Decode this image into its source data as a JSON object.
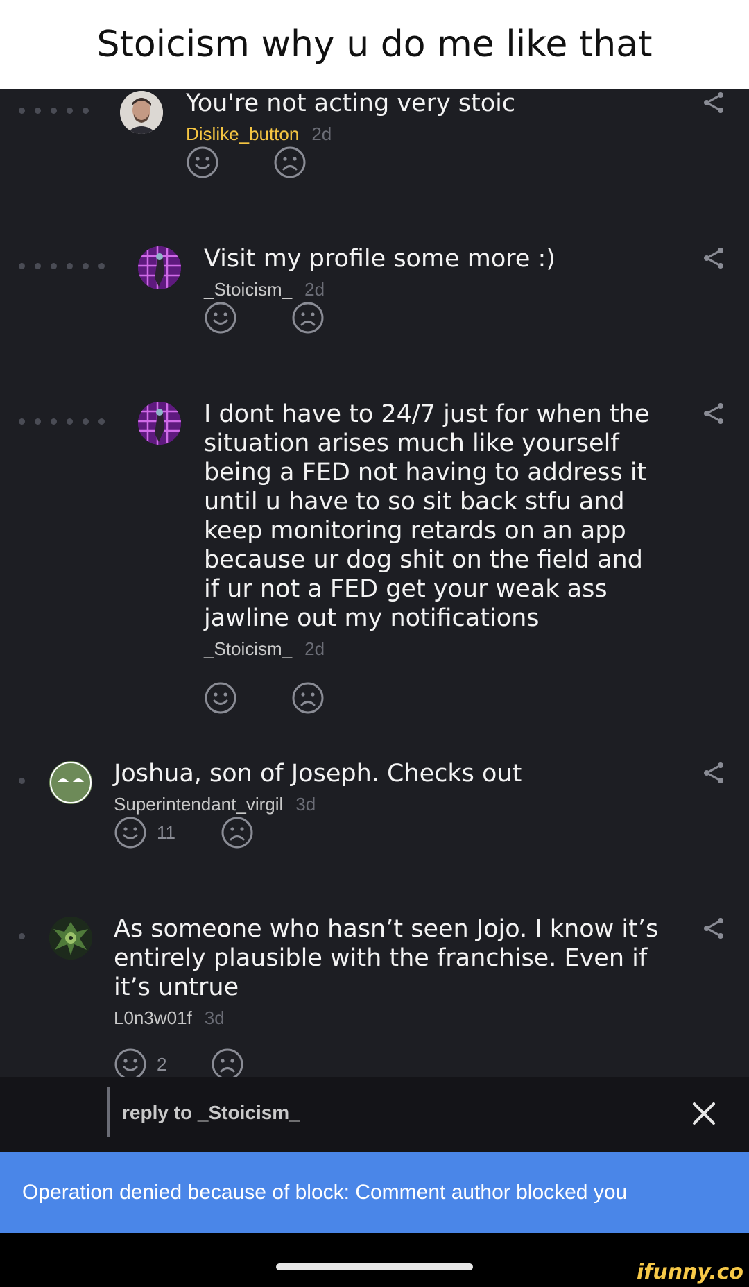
{
  "caption": "Stoicism why u do me like that",
  "comments": [
    {
      "text": "You're not acting very stoic",
      "author": "Dislike_button",
      "age": "2d",
      "likes": ""
    },
    {
      "text": "Visit my profile some more :)",
      "author": "_Stoicism_",
      "age": "2d",
      "likes": ""
    },
    {
      "text": "I dont have to 24/7 just for when the situation arises much like yourself being a FED not having to address it until u have to so sit back stfu and keep monitoring retards on an app because ur dog shit on the field and if ur not a FED get your weak ass jawline out my notifications",
      "author": "_Stoicism_",
      "age": "2d",
      "likes": ""
    },
    {
      "text": "Joshua, son of Joseph. Checks out",
      "author": "Superintendant_virgil",
      "age": "3d",
      "likes": "11"
    },
    {
      "text": "As someone who hasn’t seen Jojo. I know it’s entirely plausible with the franchise. Even if it’s untrue",
      "author": "L0n3w01f",
      "age": "3d",
      "likes": "2"
    }
  ],
  "reply_bar": {
    "label": "reply to _Stoicism_"
  },
  "toast": {
    "message": "Operation denied because of block: Comment author blocked you"
  },
  "watermark": "ifunny.co",
  "icons": {
    "like": "smile-icon",
    "dislike": "frown-icon",
    "share": "share-icon",
    "close": "close-icon"
  },
  "colors": {
    "background": "#1d1e23",
    "toast": "#4a86e8",
    "highlighted_author": "#f5c542",
    "watermark": "#f7c948"
  }
}
